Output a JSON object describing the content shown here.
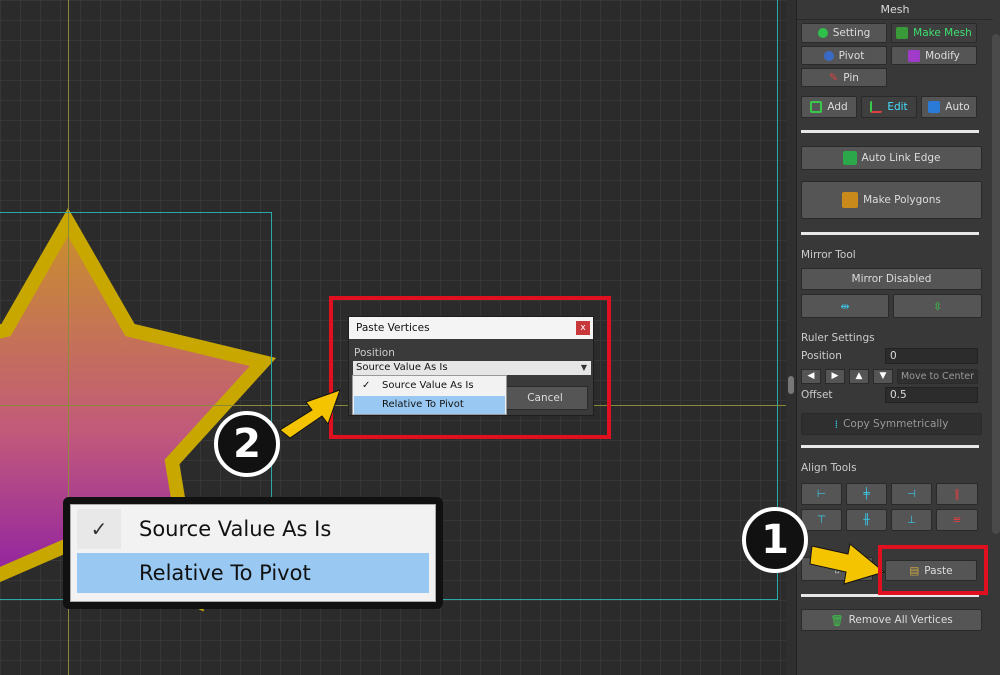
{
  "panel": {
    "title": "Mesh",
    "tabs": {
      "setting": "Setting",
      "make_mesh": "Make Mesh",
      "pivot": "Pivot",
      "modify": "Modify",
      "pin": "Pin"
    },
    "modes": {
      "add": "Add",
      "edit": "Edit",
      "auto": "Auto"
    },
    "auto_link_edge": "Auto Link Edge",
    "make_polygons": "Make Polygons",
    "mirror_tool": {
      "label": "Mirror Tool",
      "button": "Mirror Disabled"
    },
    "ruler": {
      "label": "Ruler Settings",
      "position_label": "Position",
      "position_value": "0",
      "move_to_center": "Move to Center",
      "offset_label": "Offset",
      "offset_value": "0.5",
      "copy_symmetrically": "Copy Symmetrically"
    },
    "align_tools": {
      "label": "Align Tools"
    },
    "paste": "Paste",
    "remove_all_vertices": "Remove All Vertices"
  },
  "dialog": {
    "title": "Paste Vertices",
    "close": "x",
    "position_label": "Position",
    "selected": "Source Value As Is",
    "options": [
      "Source Value As Is",
      "Relative To Pivot"
    ],
    "cancel": "Cancel"
  },
  "zoom_dropdown": {
    "options": [
      "Source Value As Is",
      "Relative To Pivot"
    ]
  },
  "callouts": {
    "one": "1",
    "two": "2"
  },
  "colors": {
    "highlight_red": "#e01020",
    "arrow_yellow": "#f5c400",
    "selection_blue": "#99c9f3",
    "accent_cyan": "#44e0ff"
  }
}
